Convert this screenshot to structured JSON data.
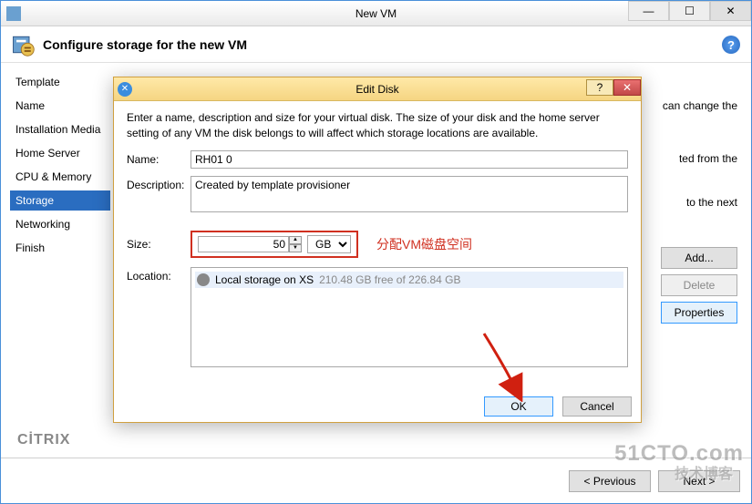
{
  "window": {
    "title": "New VM",
    "min": "—",
    "max": "☐",
    "close": "✕",
    "header": "Configure storage for the new VM"
  },
  "sidebar": {
    "items": [
      {
        "label": "Template"
      },
      {
        "label": "Name"
      },
      {
        "label": "Installation Media"
      },
      {
        "label": "Home Server"
      },
      {
        "label": "CPU & Memory"
      },
      {
        "label": "Storage",
        "selected": true
      },
      {
        "label": "Networking"
      },
      {
        "label": "Finish"
      }
    ]
  },
  "main_text": {
    "line1_suffix": "can change the",
    "line2_suffix": "ted from the",
    "line3_suffix": "to the next"
  },
  "right_buttons": {
    "add": "Add...",
    "delete": "Delete",
    "properties": "Properties"
  },
  "footer": {
    "prev": "< Previous",
    "next": "Next >",
    "logo": "CİTRIX"
  },
  "modal": {
    "title": "Edit Disk",
    "help": "?",
    "close": "✕",
    "intro": "Enter a name, description and size for your virtual disk. The size of your disk and the home server setting of any VM the disk belongs to will affect which storage locations are available.",
    "name_label": "Name:",
    "name_value": "RH01 0",
    "desc_label": "Description:",
    "desc_value": "Created by template provisioner",
    "size_label": "Size:",
    "size_value": "50",
    "size_unit": "GB",
    "annotation": "分配VM磁盘空间",
    "location_label": "Location:",
    "location_name": "Local storage on XS",
    "location_free": "210.48 GB free of 226.84 GB",
    "ok": "OK",
    "cancel": "Cancel"
  },
  "watermark": {
    "main": "51CTO.com",
    "sub": "技术博客"
  }
}
